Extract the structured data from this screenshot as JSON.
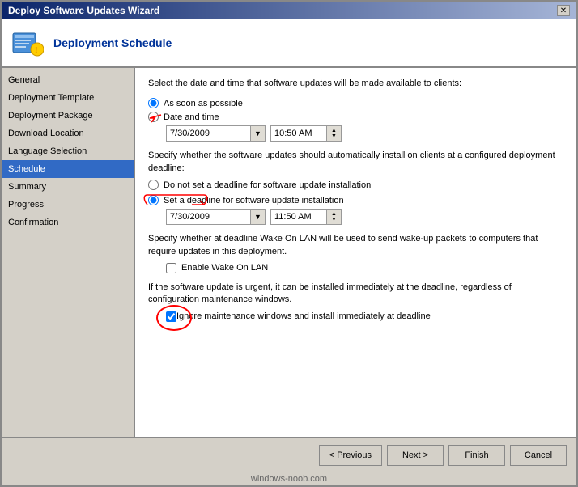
{
  "window": {
    "title": "Deploy Software Updates Wizard",
    "close_label": "✕"
  },
  "header": {
    "title": "Deployment Schedule"
  },
  "sidebar": {
    "items": [
      {
        "label": "General",
        "id": "general",
        "active": false
      },
      {
        "label": "Deployment Template",
        "id": "deployment-template",
        "active": false
      },
      {
        "label": "Deployment Package",
        "id": "deployment-package",
        "active": false
      },
      {
        "label": "Download Location",
        "id": "download-location",
        "active": false
      },
      {
        "label": "Language Selection",
        "id": "language-selection",
        "active": false
      },
      {
        "label": "Schedule",
        "id": "schedule",
        "active": true
      },
      {
        "label": "Summary",
        "id": "summary",
        "active": false
      },
      {
        "label": "Progress",
        "id": "progress",
        "active": false
      },
      {
        "label": "Confirmation",
        "id": "confirmation",
        "active": false
      }
    ]
  },
  "content": {
    "availability_desc": "Select the date and time that software updates will be made available to clients:",
    "radio_asap_label": "As soon as possible",
    "radio_datetime_label": "Date and time",
    "availability_date": "7/30/2009",
    "availability_time": "10:50 AM",
    "deadline_desc": "Specify whether the software updates should automatically install on clients at a configured deployment deadline:",
    "radio_no_deadline_label": "Do not set a deadline for software update installation",
    "radio_set_deadline_label": "Set a deadline for software update installation",
    "deadline_date": "7/30/2009",
    "deadline_time": "11:50 AM",
    "wakeup_desc": "Specify whether at deadline Wake On LAN will be used to send wake-up packets to computers that require updates in this deployment.",
    "enable_wakeup_label": "Enable Wake On LAN",
    "urgent_desc": "If the software update is urgent, it can be installed immediately at the deadline, regardless of configuration maintenance windows.",
    "ignore_maintenance_label": "Ignore maintenance windows and install immediately at deadline"
  },
  "footer": {
    "previous_label": "< Previous",
    "next_label": "Next >",
    "finish_label": "Finish",
    "cancel_label": "Cancel"
  },
  "watermark": "windows-noob.com"
}
